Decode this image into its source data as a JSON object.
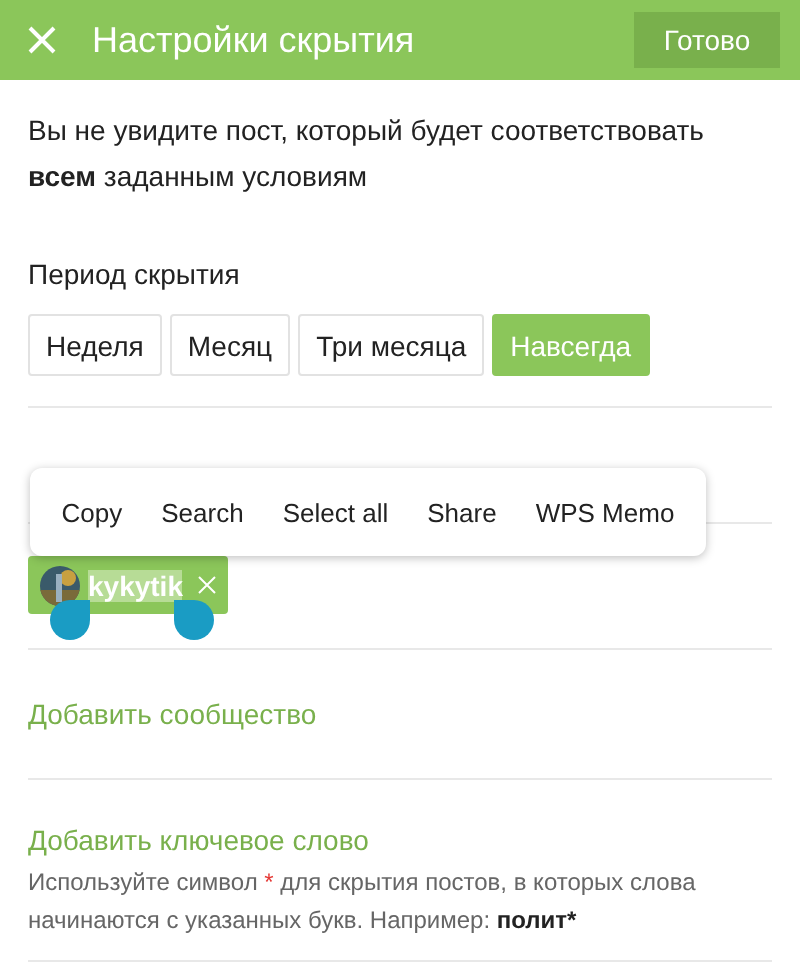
{
  "header": {
    "title": "Настройки скрытия",
    "done_button": "Готово"
  },
  "description": "Вы не увидите пост, который будет соответствовать **всем** заданным условиям",
  "period": {
    "label": "Период скрытия",
    "options": [
      {
        "label": "Неделя",
        "selected": false
      },
      {
        "label": "Месяц",
        "selected": false
      },
      {
        "label": "Три месяца",
        "selected": false
      },
      {
        "label": "Навсегда",
        "selected": true
      }
    ]
  },
  "tags": {
    "items": [
      {
        "name": "kykytik",
        "text_selected": true
      }
    ]
  },
  "context_menu": {
    "items": [
      "Copy",
      "Search",
      "Select all",
      "Share",
      "WPS Memo"
    ]
  },
  "community": {
    "add_label": "Добавить сообщество"
  },
  "keywords": {
    "add_label": "Добавить ключевое слово",
    "hint": {
      "before": "Используйте символ ",
      "mark": "*",
      "after": " для скрытия постов, в которых слова начинаются с указанных букв. Например: ",
      "example": "полит*"
    }
  }
}
